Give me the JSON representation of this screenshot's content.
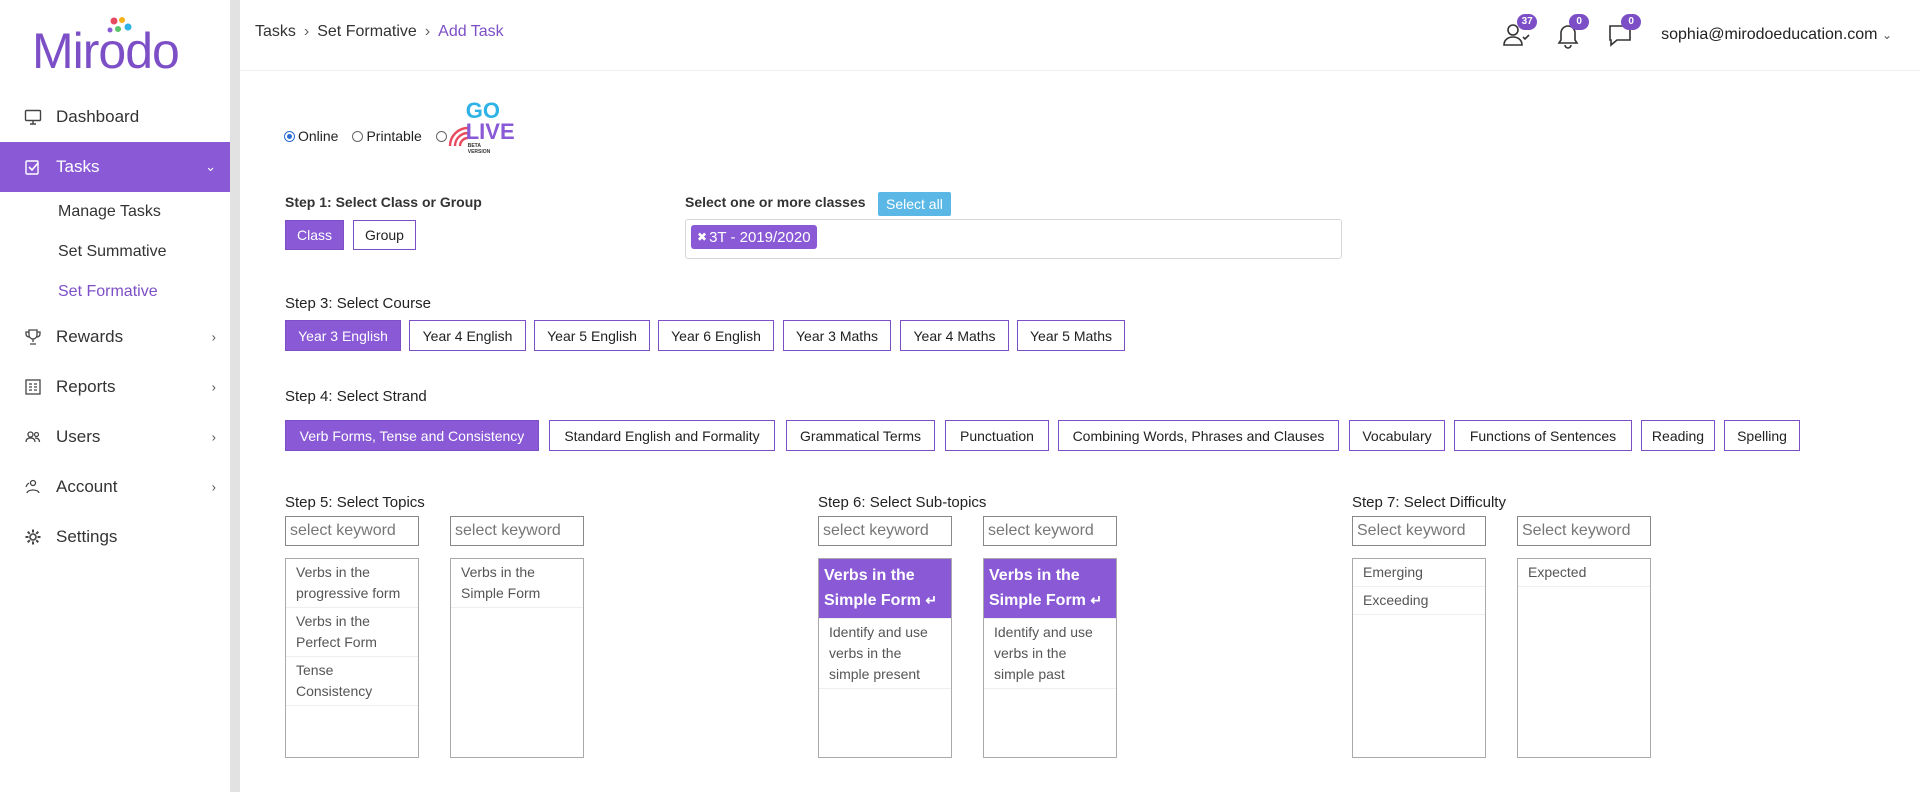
{
  "brand": {
    "logo_text": "Mirodo"
  },
  "sidebar": {
    "items": [
      {
        "label": "Dashboard",
        "icon": "monitor-icon"
      },
      {
        "label": "Tasks",
        "icon": "clipboard-check-icon",
        "active": true
      },
      {
        "label": "Rewards",
        "icon": "trophy-icon"
      },
      {
        "label": "Reports",
        "icon": "report-icon"
      },
      {
        "label": "Users",
        "icon": "users-icon"
      },
      {
        "label": "Account",
        "icon": "account-icon"
      },
      {
        "label": "Settings",
        "icon": "gear-icon"
      }
    ],
    "subitems": [
      "Manage Tasks",
      "Set Summative",
      "Set Formative"
    ]
  },
  "header": {
    "breadcrumb": [
      "Tasks",
      "Set Formative",
      "Add Task"
    ],
    "badges": {
      "users": "37",
      "notifications": "0",
      "messages": "0"
    },
    "user_email": "sophia@mirodoeducation.com"
  },
  "mode": {
    "online": "Online",
    "printable": "Printable",
    "golive_top": "GO",
    "golive_bottom": "LIVE",
    "golive_beta": "BETA VERSION"
  },
  "step1": {
    "label": "Step 1: Select Class or Group",
    "class_btn": "Class",
    "group_btn": "Group"
  },
  "classes": {
    "label": "Select one or more classes",
    "select_all": "Select all",
    "chip": "3T - 2019/2020"
  },
  "step3": {
    "label": "Step 3: Select Course",
    "courses": [
      "Year 3 English",
      "Year 4 English",
      "Year 5 English",
      "Year 6 English",
      "Year 3 Maths",
      "Year 4 Maths",
      "Year 5 Maths"
    ]
  },
  "step4": {
    "label": "Step 4: Select Strand",
    "strands": [
      "Verb Forms, Tense and Consistency",
      "Standard English and Formality",
      "Grammatical Terms",
      "Punctuation",
      "Combining Words, Phrases and Clauses",
      "Vocabulary",
      "Functions of Sentences",
      "Reading",
      "Spelling"
    ]
  },
  "step5": {
    "label": "Step 5: Select Topics",
    "placeholder": "select keyword",
    "list_a": [
      "Verbs in the progressive form",
      "Verbs in the Perfect Form",
      "Tense Consistency"
    ],
    "list_b": [
      "Verbs in the Simple Form"
    ]
  },
  "step6": {
    "label": "Step 6: Select Sub-topics",
    "placeholder": "select keyword",
    "list_a_header": "Verbs in the Simple Form",
    "list_a": [
      "Identify and use verbs in the simple present"
    ],
    "list_b_header": "Verbs in the Simple Form",
    "list_b": [
      "Identify and use verbs in the simple past"
    ]
  },
  "step7": {
    "label": "Step 7: Select Difficulty",
    "placeholder": "Select keyword",
    "list_a": [
      "Emerging",
      "Exceeding"
    ],
    "list_b": [
      "Expected"
    ]
  },
  "colors": {
    "accent": "#8a5ad6",
    "select_all": "#5bb8e6"
  }
}
